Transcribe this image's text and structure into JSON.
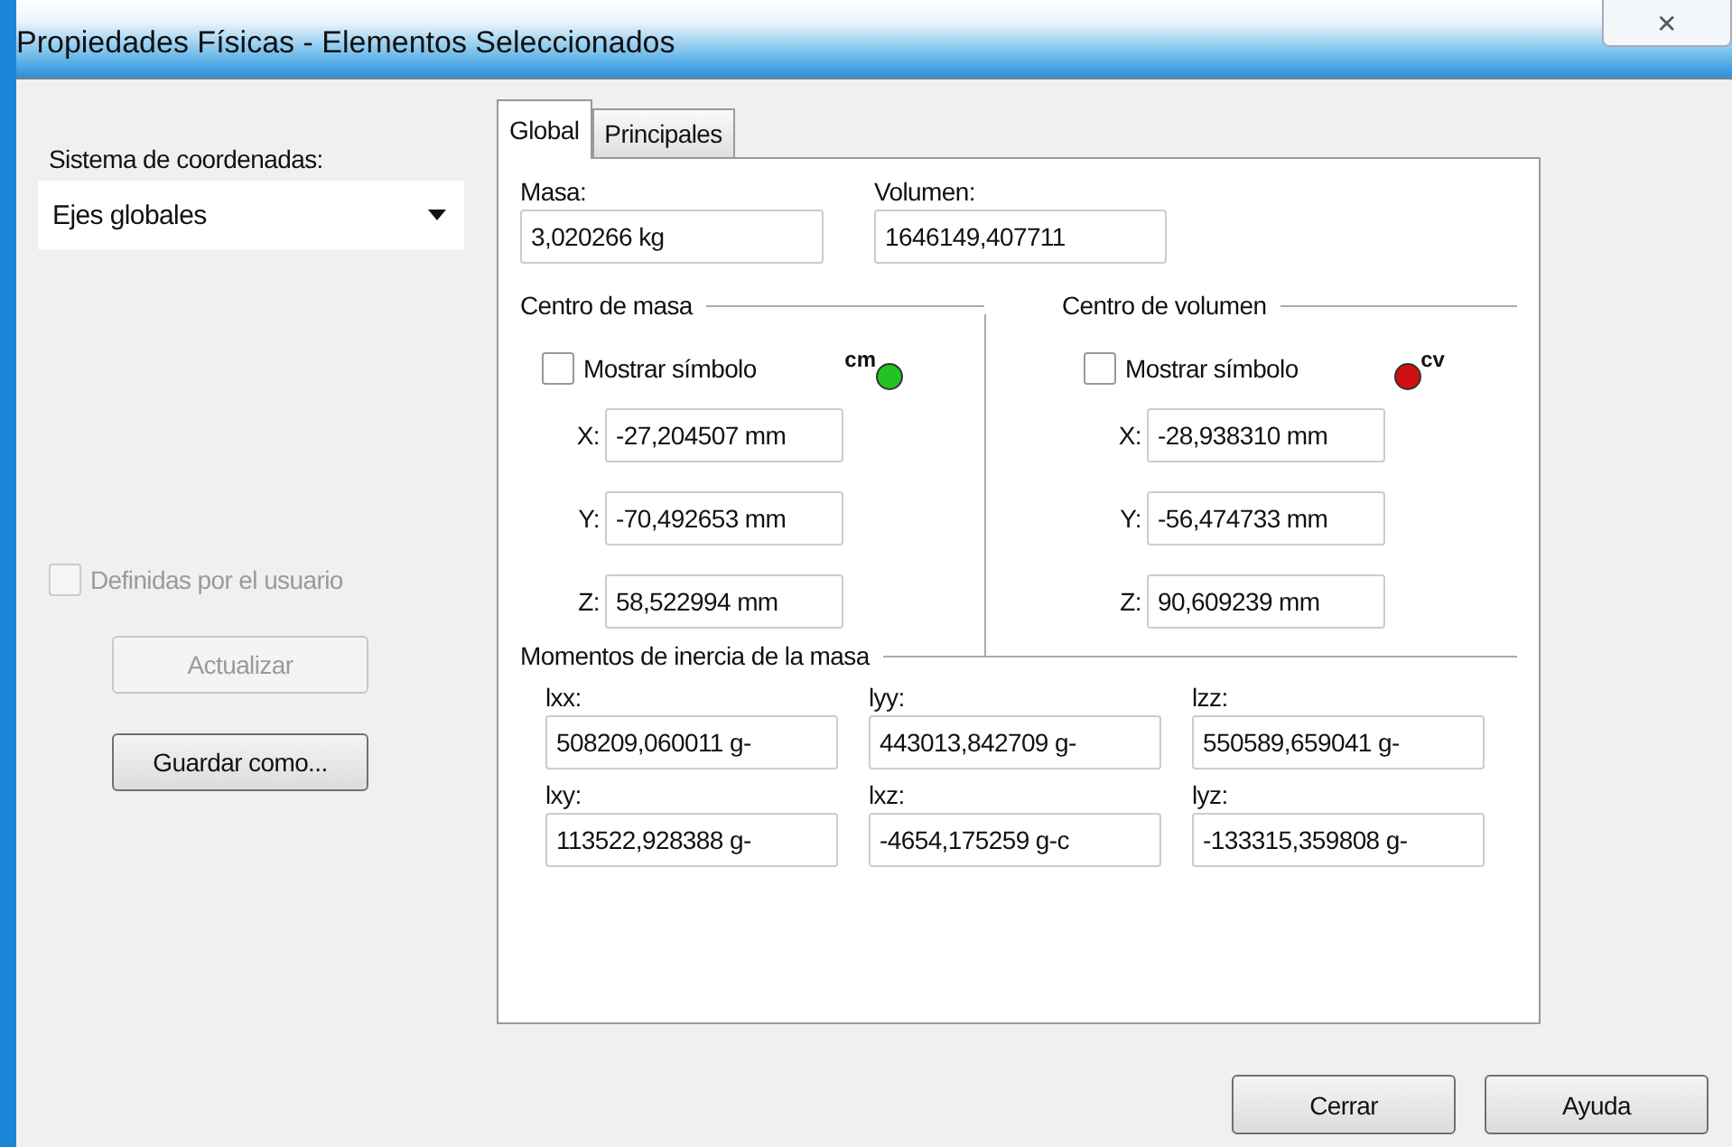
{
  "window": {
    "title": "Propiedades Físicas - Elementos Seleccionados",
    "close": "✕"
  },
  "coordinate_system": {
    "label": "Sistema de coordenadas:",
    "value": "Ejes globales"
  },
  "user_defined": {
    "label": "Definidas por el usuario",
    "checked": false,
    "disabled": true
  },
  "side_buttons": [
    {
      "label": "Actualizar",
      "disabled": true
    },
    {
      "label": "Guardar como...",
      "disabled": false
    }
  ],
  "tabs": [
    {
      "label": "Global",
      "selected": true
    },
    {
      "label": "Principales",
      "selected": false
    }
  ],
  "mass": {
    "label": "Masa:",
    "value": "3,020266 kg"
  },
  "volume": {
    "label": "Volumen:",
    "value": "1646149,407711"
  },
  "centers": [
    {
      "title": "Centro de masa",
      "show_symbol": {
        "label": "Mostrar símbolo",
        "checked": false
      },
      "symbol": {
        "text": "cm",
        "color": "#22c322",
        "kind": "leading"
      },
      "coords": [
        {
          "label": "X:",
          "value": "-27,204507 mm"
        },
        {
          "label": "Y:",
          "value": "-70,492653 mm"
        },
        {
          "label": "Z:",
          "value": "58,522994 mm"
        }
      ]
    },
    {
      "title": "Centro de volumen",
      "show_symbol": {
        "label": "Mostrar símbolo",
        "checked": false
      },
      "symbol": {
        "text": "cv",
        "color": "#d01010",
        "kind": "trailing"
      },
      "coords": [
        {
          "label": "X:",
          "value": "-28,938310 mm"
        },
        {
          "label": "Y:",
          "value": "-56,474733 mm"
        },
        {
          "label": "Z:",
          "value": "90,609239 mm"
        }
      ]
    }
  ],
  "inertia": {
    "title": "Momentos de inercia de la masa",
    "items": [
      {
        "label": "lxx:",
        "value": "508209,060011 g-"
      },
      {
        "label": "lyy:",
        "value": "443013,842709 g-"
      },
      {
        "label": "lzz:",
        "value": "550589,659041 g-"
      },
      {
        "label": "lxy:",
        "value": "113522,928388 g-"
      },
      {
        "label": "lxz:",
        "value": "-4654,175259 g-c"
      },
      {
        "label": "lyz:",
        "value": "-133315,359808 g-"
      }
    ]
  },
  "buttons": [
    "Cerrar",
    "Ayuda"
  ]
}
